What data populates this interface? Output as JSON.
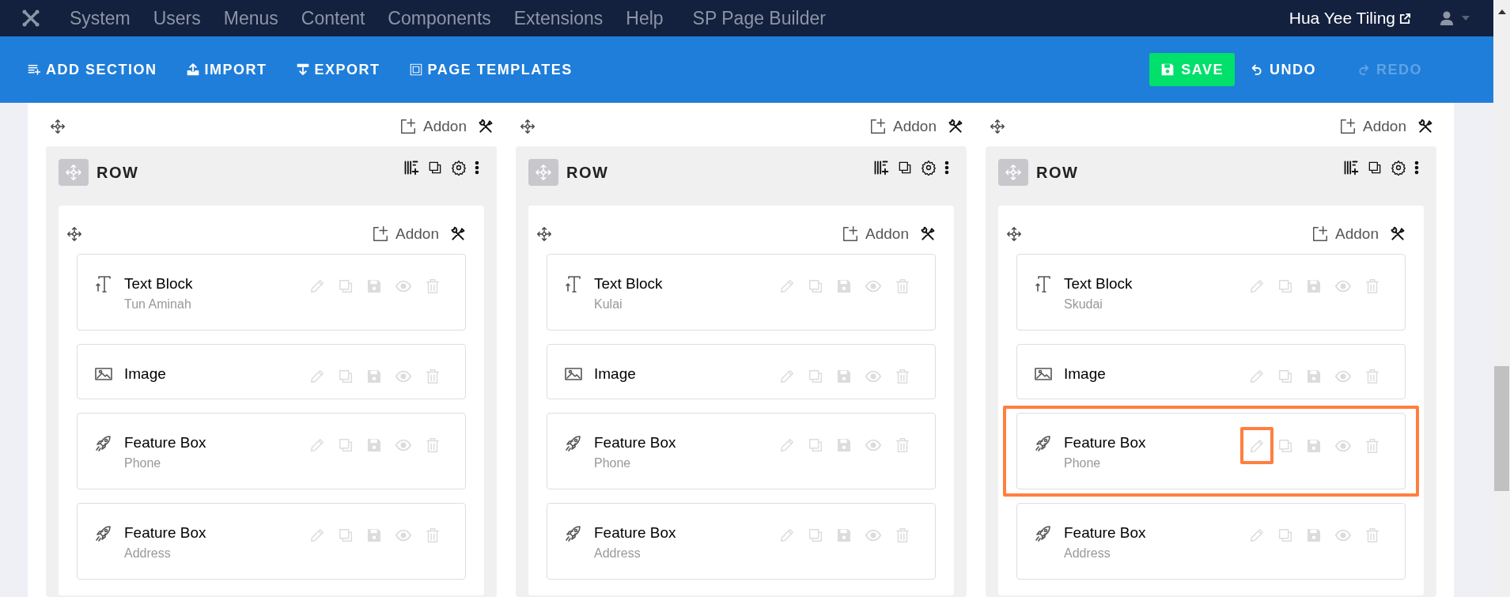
{
  "top_nav": {
    "menu": [
      "System",
      "Users",
      "Menus",
      "Content",
      "Components",
      "Extensions",
      "Help",
      "SP Page Builder"
    ],
    "user_name": "Hua Yee Tiling"
  },
  "toolbar": {
    "actions": [
      {
        "kind": "add-section",
        "label": "ADD SECTION"
      },
      {
        "kind": "import",
        "label": "IMPORT"
      },
      {
        "kind": "export",
        "label": "EXPORT"
      },
      {
        "kind": "templates",
        "label": "PAGE TEMPLATES"
      }
    ],
    "save": "SAVE",
    "undo": {
      "label": "UNDO",
      "disabled": false
    },
    "redo": {
      "label": "REDO",
      "disabled": true
    }
  },
  "columns": [
    {
      "addon_label": "Addon",
      "row_title": "ROW",
      "inner_addon_label": "Addon",
      "addons": [
        {
          "kind": "text",
          "title": "Text Block",
          "subtitle": "Tun Aminah",
          "highlighted": false,
          "edit_highlighted": false
        },
        {
          "kind": "image",
          "title": "Image",
          "highlighted": false,
          "edit_highlighted": false
        },
        {
          "kind": "feature",
          "title": "Feature Box",
          "subtitle": "Phone",
          "highlighted": false,
          "edit_highlighted": false
        },
        {
          "kind": "feature",
          "title": "Feature Box",
          "subtitle": "Address",
          "highlighted": false,
          "edit_highlighted": false
        }
      ]
    },
    {
      "addon_label": "Addon",
      "row_title": "ROW",
      "inner_addon_label": "Addon",
      "addons": [
        {
          "kind": "text",
          "title": "Text Block",
          "subtitle": "Kulai",
          "highlighted": false,
          "edit_highlighted": false
        },
        {
          "kind": "image",
          "title": "Image",
          "highlighted": false,
          "edit_highlighted": false
        },
        {
          "kind": "feature",
          "title": "Feature Box",
          "subtitle": "Phone",
          "highlighted": false,
          "edit_highlighted": false
        },
        {
          "kind": "feature",
          "title": "Feature Box",
          "subtitle": "Address",
          "highlighted": false,
          "edit_highlighted": false
        }
      ]
    },
    {
      "addon_label": "Addon",
      "row_title": "ROW",
      "inner_addon_label": "Addon",
      "addons": [
        {
          "kind": "text",
          "title": "Text Block",
          "subtitle": "Skudai",
          "highlighted": false,
          "edit_highlighted": false
        },
        {
          "kind": "image",
          "title": "Image",
          "highlighted": false,
          "edit_highlighted": false
        },
        {
          "kind": "feature",
          "title": "Feature Box",
          "subtitle": "Phone",
          "highlighted": true,
          "edit_highlighted": true
        },
        {
          "kind": "feature",
          "title": "Feature Box",
          "subtitle": "Address",
          "highlighted": false,
          "edit_highlighted": false
        }
      ]
    }
  ]
}
